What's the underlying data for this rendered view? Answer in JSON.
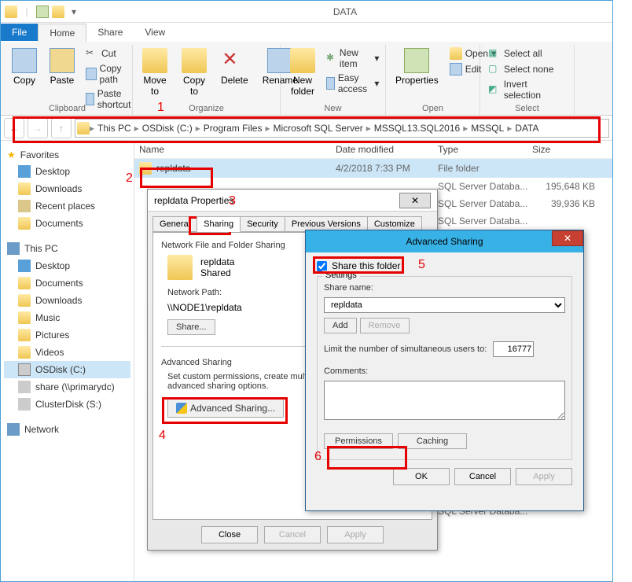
{
  "window": {
    "title": "DATA",
    "tabs": {
      "file": "File",
      "home": "Home",
      "share": "Share",
      "view": "View"
    }
  },
  "ribbon": {
    "clipboard": {
      "copy": "Copy",
      "paste": "Paste",
      "cut": "Cut",
      "copypath": "Copy path",
      "shortcut": "Paste shortcut",
      "label": "Clipboard"
    },
    "organize": {
      "moveto": "Move\nto",
      "copyto": "Copy\nto",
      "delete": "Delete",
      "rename": "Rename",
      "label": "Organize"
    },
    "new": {
      "newfolder": "New\nfolder",
      "newitem": "New item",
      "easyaccess": "Easy access",
      "label": "New"
    },
    "open": {
      "properties": "Properties",
      "open": "Open",
      "edit": "Edit",
      "label": "Open"
    },
    "select": {
      "selectall": "Select all",
      "selectnone": "Select none",
      "invert": "Invert selection",
      "label": "Select"
    }
  },
  "breadcrumb": [
    "This PC",
    "OSDisk (C:)",
    "Program Files",
    "Microsoft SQL Server",
    "MSSQL13.SQL2016",
    "MSSQL",
    "DATA"
  ],
  "columns": {
    "name": "Name",
    "date": "Date modified",
    "type": "Type",
    "size": "Size"
  },
  "rows": [
    {
      "name": "repldata",
      "date": "4/2/2018 7:33 PM",
      "type": "File folder",
      "size": ""
    },
    {
      "name": "",
      "date": "",
      "type": "SQL Server Databa...",
      "size": "195,648 KB"
    },
    {
      "name": "",
      "date": "",
      "type": "SQL Server Databa...",
      "size": "39,936 KB"
    },
    {
      "name": "",
      "date": "",
      "type": "SQL Server Databa...",
      "size": ""
    },
    {
      "name": "",
      "date": "",
      "type": "SQL Server Databa...",
      "size": ""
    }
  ],
  "nav": {
    "favorites": "Favorites",
    "fav_items": [
      "Desktop",
      "Downloads",
      "Recent places",
      "Documents"
    ],
    "thispc": "This PC",
    "pc_items": [
      "Desktop",
      "Documents",
      "Downloads",
      "Music",
      "Pictures",
      "Videos",
      "OSDisk (C:)",
      "share (\\\\primarydc)",
      "ClusterDisk (S:)"
    ],
    "network": "Network"
  },
  "props": {
    "title": "repldata Properties",
    "tabs": {
      "general": "General",
      "sharing": "Sharing",
      "security": "Security",
      "prev": "Previous Versions",
      "cust": "Customize"
    },
    "nfs_head": "Network File and Folder Sharing",
    "folder_name": "repldata",
    "shared": "Shared",
    "netpath_lbl": "Network Path:",
    "netpath": "\\\\NODE1\\repldata",
    "share_btn": "Share...",
    "adv_head": "Advanced Sharing",
    "adv_desc": "Set custom permissions, create multiple shares, and set other advanced sharing options.",
    "adv_btn": "Advanced Sharing...",
    "close": "Close",
    "cancel": "Cancel",
    "apply": "Apply"
  },
  "adv": {
    "title": "Advanced Sharing",
    "share_chk": "Share this folder",
    "settings": "Settings",
    "sharename_lbl": "Share name:",
    "sharename": "repldata",
    "add": "Add",
    "remove": "Remove",
    "limit_lbl": "Limit the number of simultaneous users to:",
    "limit": "16777",
    "comments_lbl": "Comments:",
    "perm": "Permissions",
    "caching": "Caching",
    "ok": "OK",
    "cancel": "Cancel",
    "apply": "Apply"
  },
  "annotations": {
    "n1": "1",
    "n2": "2",
    "n3": "3",
    "n4": "4",
    "n5": "5",
    "n6": "6"
  }
}
